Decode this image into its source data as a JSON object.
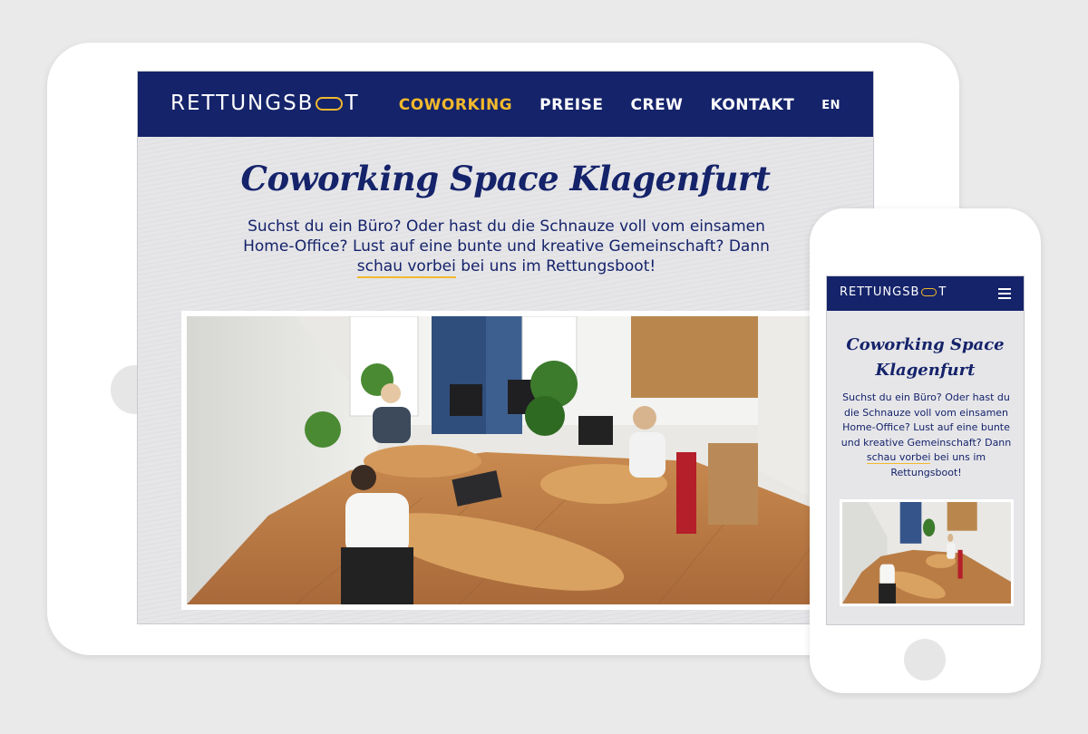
{
  "tablet": {
    "brand": "RETTUNGSB",
    "brand_end": "T",
    "nav": [
      "COWORKING",
      "PREISE",
      "CREW",
      "KONTAKT",
      "EN"
    ],
    "title": "Coworking Space Klagenfurt",
    "text_before": "Suchst du ein Büro? Oder hast du die Schnauze voll vom einsamen Home-Office? Lust auf eine bunte und kreative Gemeinschaft? Dann ",
    "text_link": "schau vorbei",
    "text_after": " bei uns im Rettungsboot!"
  },
  "phone": {
    "brand": "RETTUNGSB",
    "brand_end": "T",
    "title": "Coworking Space Klagenfurt",
    "text_before": "Suchst du ein Büro? Oder hast du die Schnauze voll vom einsamen Home-Office? Lust auf eine bunte und kreative Gemeinschaft? Dann ",
    "text_link": "schau vorbei",
    "text_after": " bei uns im Rettungsboot!"
  },
  "colors": {
    "navy": "#15236a",
    "gold": "#f2b92c",
    "background": "#eaeaea"
  },
  "icons": {
    "logo": "boat-oval-logo-icon",
    "menu": "hamburger-menu-icon",
    "photo": "coworking-office-photo"
  }
}
